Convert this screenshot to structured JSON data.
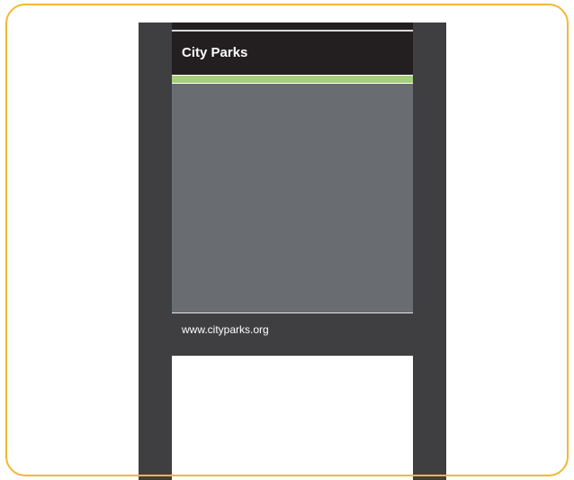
{
  "sign": {
    "title": "City Parks",
    "url": "www.cityparks.org"
  },
  "colors": {
    "frame_border": "#f2b830",
    "post": "#3f3f41",
    "header": "#231f20",
    "accent_stripe": "#a6ce7b",
    "map_panel": "#696c70",
    "footer": "#3f3f41",
    "text": "#ffffff"
  }
}
